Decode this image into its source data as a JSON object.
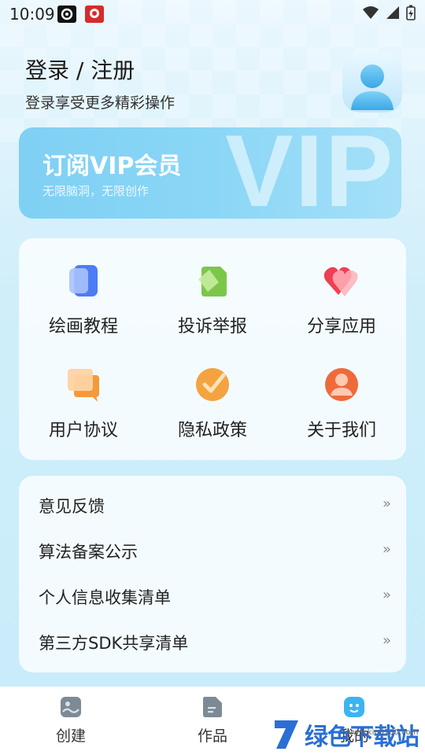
{
  "status_bar": {
    "time": "10:09"
  },
  "header": {
    "login_title": "登录 / 注册",
    "login_subtitle": "登录享受更多精彩操作"
  },
  "vip_banner": {
    "title": "订阅VIP会员",
    "subtitle": "无限脑洞，无限创作",
    "watermark": "VIP"
  },
  "grid": {
    "items": [
      {
        "label": "绘画教程",
        "icon": "drawing-tutorial-icon",
        "color": "#4d7cf6"
      },
      {
        "label": "投诉举报",
        "icon": "report-icon",
        "color": "#7cc74a"
      },
      {
        "label": "分享应用",
        "icon": "heart-share-icon",
        "color": "#ef5a6a"
      },
      {
        "label": "用户协议",
        "icon": "chat-agreement-icon",
        "color": "#f59a3a"
      },
      {
        "label": "隐私政策",
        "icon": "privacy-check-icon",
        "color": "#f4a340"
      },
      {
        "label": "关于我们",
        "icon": "user-about-icon",
        "color": "#ef6a3a"
      }
    ]
  },
  "list": {
    "items": [
      {
        "label": "意见反馈",
        "chevron": "»"
      },
      {
        "label": "算法备案公示",
        "chevron": "»"
      },
      {
        "label": "个人信息收集清单",
        "chevron": "»"
      },
      {
        "label": "第三方SDK共享清单",
        "chevron": "»"
      }
    ]
  },
  "bottom_nav": {
    "items": [
      {
        "label": "创建",
        "icon": "create-icon"
      },
      {
        "label": "作品",
        "icon": "works-icon"
      },
      {
        "label": "我的",
        "icon": "profile-icon"
      }
    ]
  },
  "watermark": {
    "text": "绿色下载站",
    "url": "www.kimi100.com"
  }
}
